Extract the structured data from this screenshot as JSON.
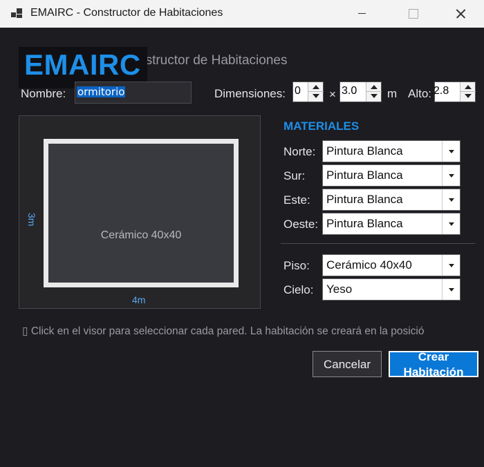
{
  "window": {
    "title": "EMAIRC - Constructor de Habitaciones"
  },
  "header": {
    "logo": "EMAIRC",
    "subtitle": "nstructor de Habitaciones"
  },
  "form": {
    "name_label": "Nombre:",
    "name_value": "ormitorio",
    "dimensions_label": "Dimensiones:",
    "width_value": "0",
    "times": "×",
    "depth_value": "3.0",
    "unit": "m",
    "height_label": "Alto:",
    "height_value": "2.8"
  },
  "viewer": {
    "floor_label": "Cerámico 40x40",
    "width_label": "4m",
    "depth_label": "3m"
  },
  "materials": {
    "title": "MATERIALES",
    "walls": [
      {
        "label": "Norte:",
        "value": "Pintura Blanca"
      },
      {
        "label": "Sur:",
        "value": "Pintura Blanca"
      },
      {
        "label": "Este:",
        "value": "Pintura Blanca"
      },
      {
        "label": "Oeste:",
        "value": "Pintura Blanca"
      }
    ],
    "floor": {
      "label": "Piso:",
      "value": "Cerámico 40x40"
    },
    "ceiling": {
      "label": "Cielo:",
      "value": "Yeso"
    }
  },
  "hint": "▯ Click en el visor para seleccionar cada pared. La habitación se creará en la posició",
  "buttons": {
    "cancel": "Cancelar",
    "create_line1": "Crear",
    "create_line2": "Habitación"
  }
}
